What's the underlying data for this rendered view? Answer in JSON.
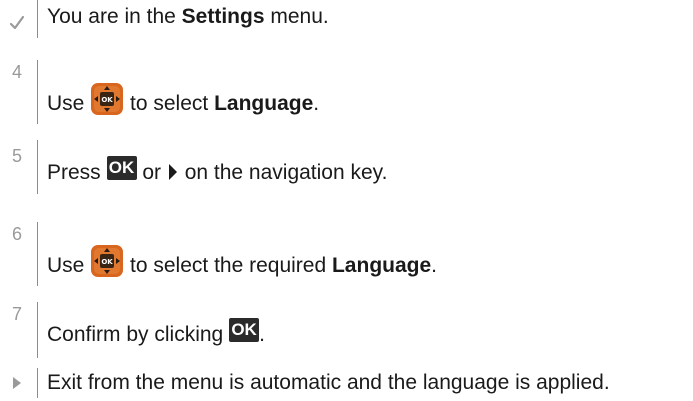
{
  "steps": [
    {
      "marker": "✓",
      "marker_icon": "checkmark-icon",
      "parts": [
        "You are in the ",
        "Settings",
        " menu."
      ]
    },
    {
      "marker": "4",
      "parts": [
        "Use ",
        " to select ",
        "Language",
        "."
      ],
      "icon": "navigation-key-icon"
    },
    {
      "marker": "5",
      "parts": [
        "Press ",
        " or ",
        " on the navigation key."
      ],
      "ok_label": "OK",
      "icon": "right-arrow-icon"
    },
    {
      "marker": "6",
      "parts": [
        "Use ",
        " to select the required ",
        "Language",
        "."
      ],
      "icon": "navigation-key-icon"
    },
    {
      "marker": "7",
      "parts": [
        "Confirm by clicking ",
        "."
      ],
      "ok_label": "OK"
    },
    {
      "marker": "▸",
      "marker_icon": "result-arrow-icon",
      "parts": [
        "Exit from the menu is automatic and the language is applied."
      ]
    }
  ],
  "colors": {
    "text": "#1a1a1a",
    "marker": "#9a9a9a",
    "rule": "#8c8c8c",
    "ok_key_bg": "#2b2b2b",
    "nav_key_orange": "#d9661f",
    "nav_key_dark": "#8a3a0e"
  }
}
